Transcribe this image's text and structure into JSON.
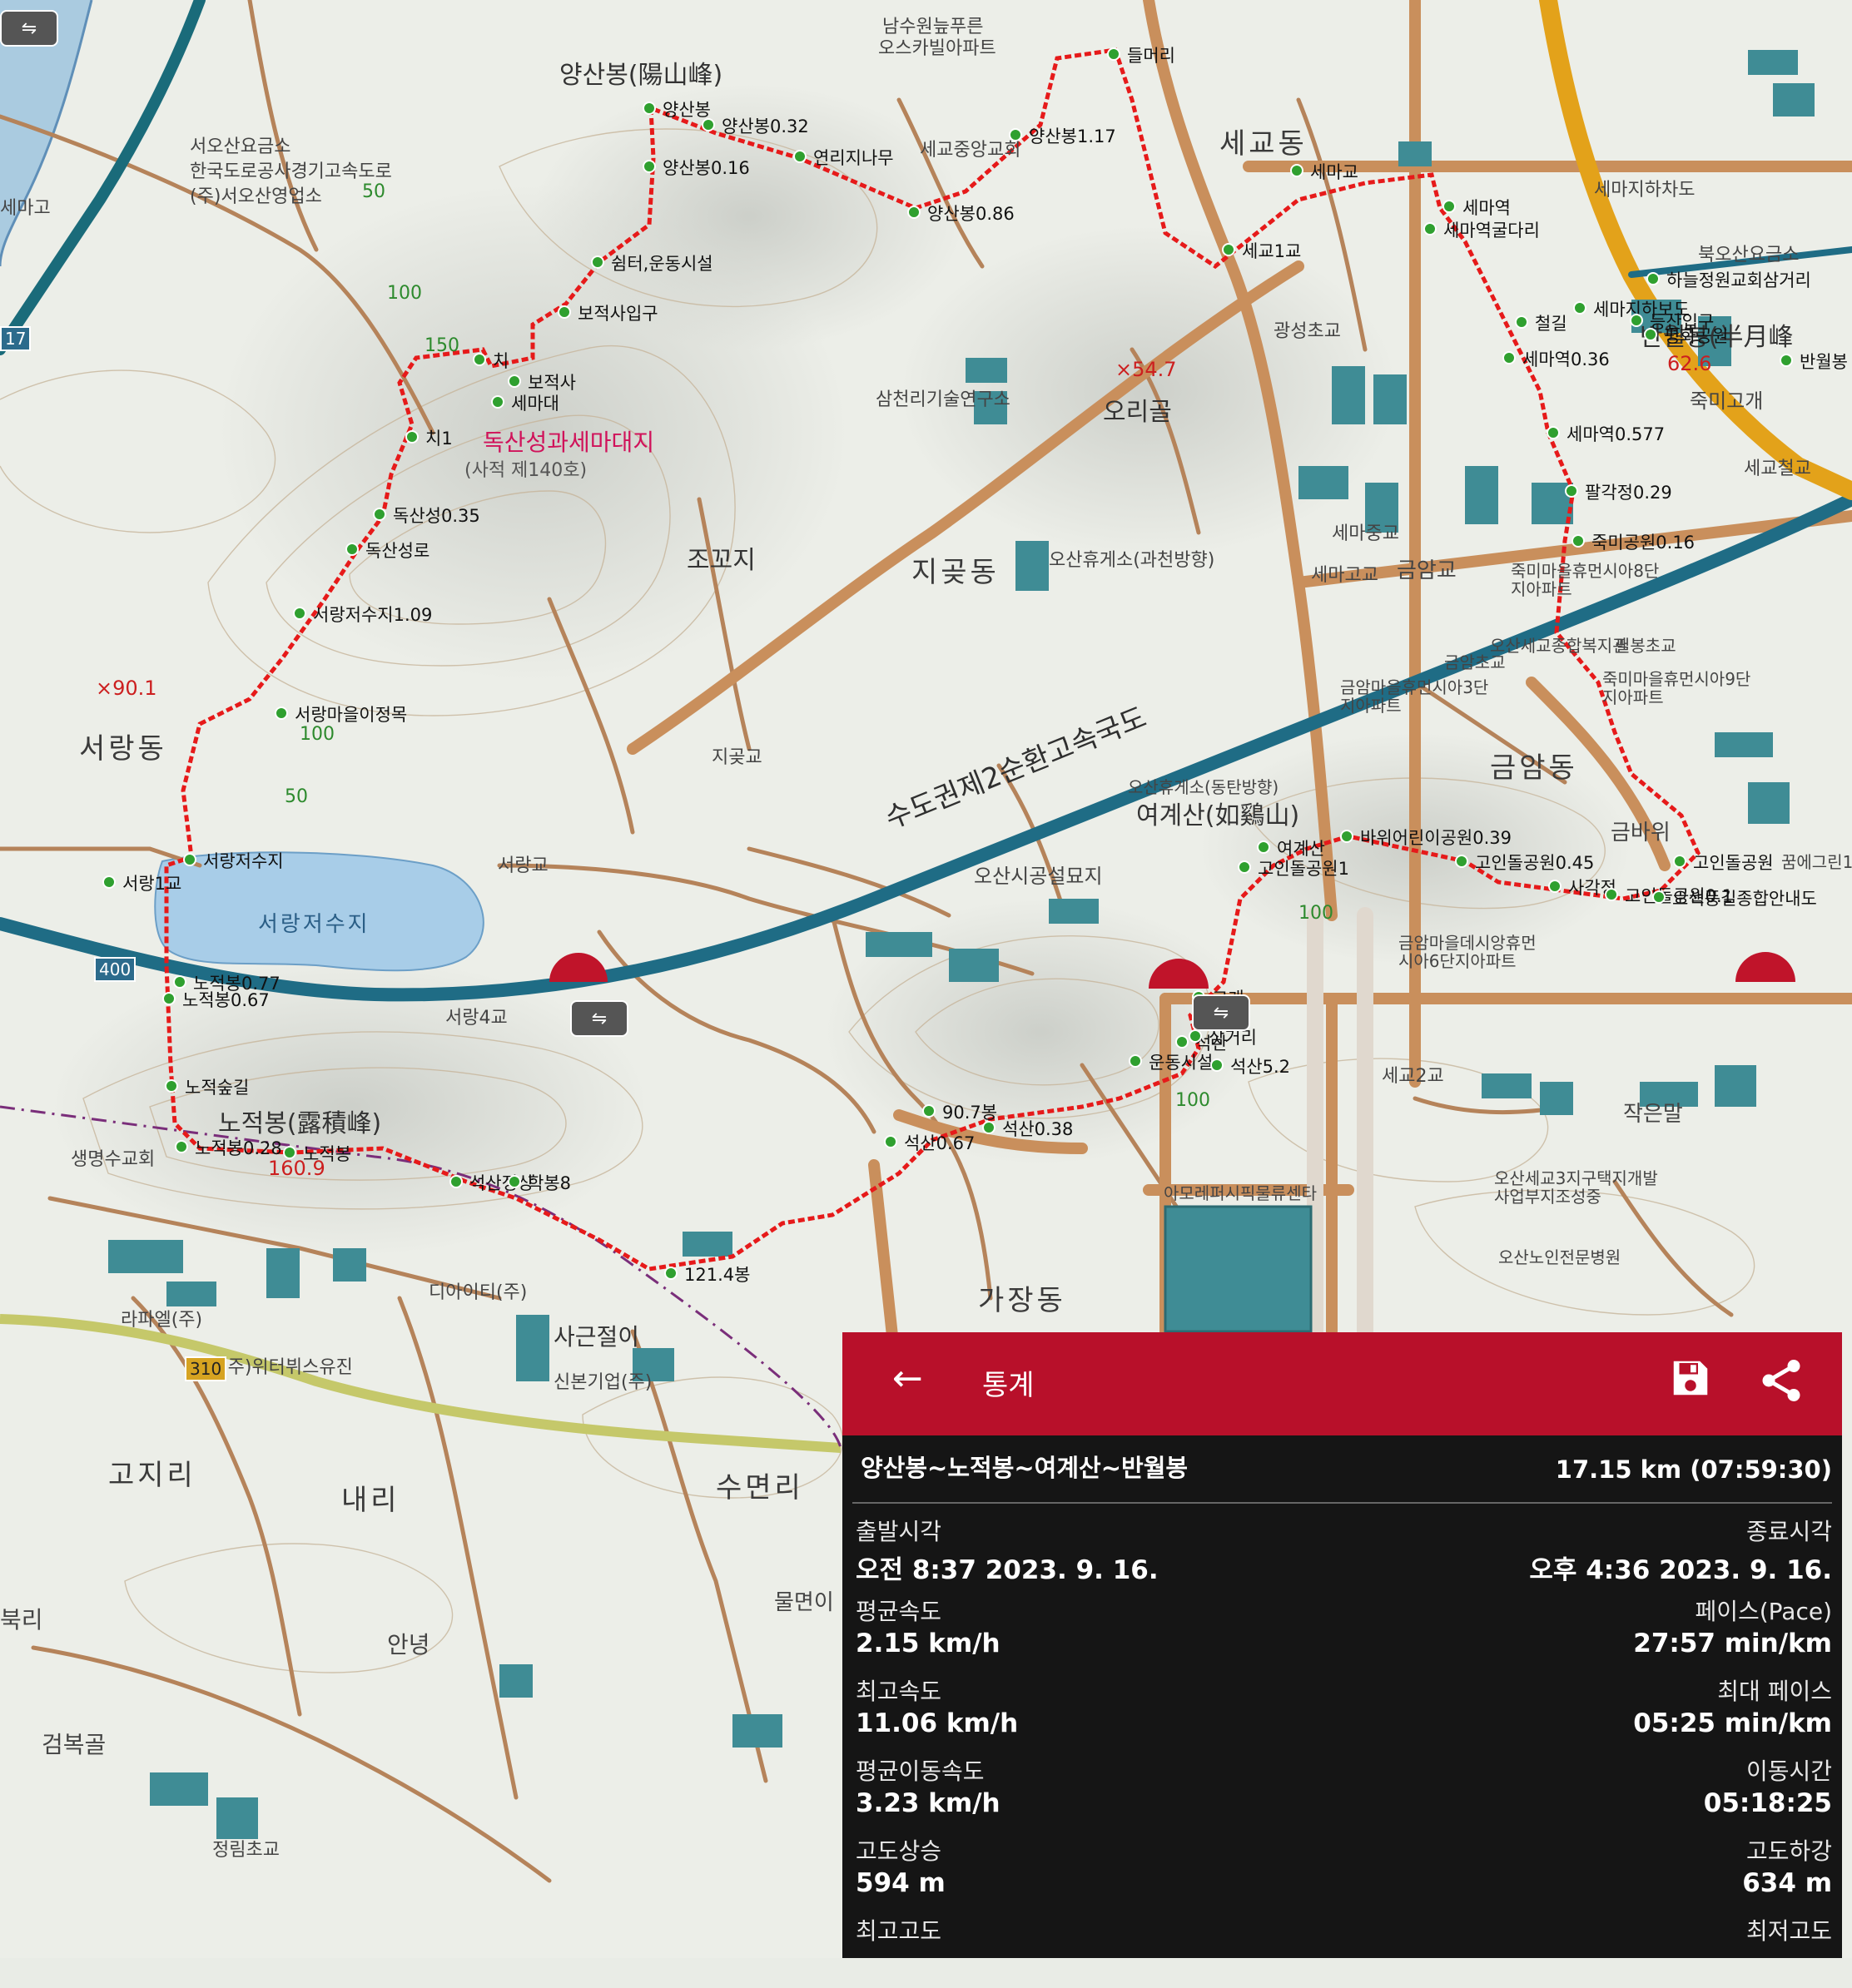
{
  "map": {
    "area_labels": [
      "서랑동",
      "지곶동",
      "가장동",
      "금암동",
      "고지리",
      "내리",
      "수면리",
      "세교동"
    ],
    "peak_labels": [
      "양산봉(陽山峰)",
      "노적봉(露積峰)",
      "여계산(如鷄山)",
      "반월봉(半月峰"
    ],
    "elevations": [
      "×90.1",
      "×54.7",
      "160.9",
      "62.6"
    ],
    "contour_labels": [
      "50",
      "100",
      "150",
      "100",
      "50",
      "100",
      "100"
    ],
    "place_labels": [
      "서오산요금소",
      "한국도로공사경기고속도로",
      "(주)서오산영업소",
      "세마고",
      "남수원늪푸른",
      "오스카빌아파트",
      "세교중앙교회",
      "삼천리기술연구소",
      "오리골",
      "광성초교",
      "세마지하차도",
      "북오산요금소",
      "죽미고개",
      "세교철교",
      "조꼬지",
      "서랑교",
      "서랑저수지",
      "지곶교",
      "서랑4교",
      "오산시공설묘지",
      "오산휴게소(과천방향)",
      "오산휴게소(동탄방향)",
      "세마중교",
      "세마고교",
      "금암교",
      "죽미마을휴먼시아8단지아파트",
      "오산세교종합복지관",
      "필봉초교",
      "금암마을휴먼시아3단지아파트",
      "죽미마을휴먼시아9단지아파트",
      "금암초교",
      "금바위",
      "꿈에그린13단지",
      "금암마을데시앙휴먼시아6단지아파트",
      "아모레퍼시픽물류센타",
      "오산세교3지구택지개발사업부지조성중",
      "오산노인전문병원",
      "작은말",
      "세교2교",
      "디아이티(주)",
      "사근절이",
      "라파엘(주)",
      "(주)위터뷔스유진",
      "신본기업(주)",
      "생명수교회",
      "안녕",
      "검복골",
      "정림초교",
      "물면이",
      "북리"
    ],
    "highway_label": "수도권제2순환고속국도",
    "route_badges": [
      "400",
      "310",
      "17"
    ],
    "heritage_label": "독산성과세마대지",
    "heritage_sub": "(사적 제140호)",
    "waypoints": [
      "양산봉",
      "양산봉0.32",
      "양산봉0.16",
      "연리지나무",
      "양산봉0.86",
      "양산봉1.17",
      "들머리",
      "쉼터,운동시설",
      "보적사입구",
      "보적사",
      "세마대",
      "치",
      "치1",
      "독산성0.35",
      "독산성로",
      "서랑저수지1.09",
      "서랑마을이정목",
      "서랑저수지",
      "서랑1교",
      "노적봉0.77",
      "노적봉0.67",
      "노적숲길",
      "노적봉0.28",
      "노적봉",
      "석산정상",
      "학봉8",
      "121.4봉",
      "석산0.67",
      "석산0.38",
      "90.7봉",
      "운동시설",
      "석산",
      "석산5.2",
      "삼거리",
      "고개",
      "여계산",
      "고인돌공원1",
      "바위어린이공원0.39",
      "고인돌공원0.45",
      "사각정",
      "고인돌공원",
      "고인돌공원0.1",
      "오색풍길종합안내도",
      "죽미공원0.16",
      "팔각정0.29",
      "세마역0.577",
      "세마역0.36",
      "철길",
      "세마역",
      "세마역굴다리",
      "세마지하보도",
      "하늘정원교회삼거리",
      "등산입구",
      "평화공원",
      "반월봉",
      "세마교",
      "세교1교"
    ]
  },
  "panel": {
    "title": "통계",
    "back_icon": "arrow-left",
    "save_icon": "save",
    "share_icon": "share",
    "track_name": "양산봉~노적봉~여계산~반월봉",
    "distance": "17.15 km (07:59:30)",
    "stats": [
      {
        "left_label": "출발시각",
        "left_value": "오전 8:37 2023. 9. 16.",
        "right_label": "종료시각",
        "right_value": "오후 4:36 2023. 9. 16."
      },
      {
        "left_label": "평균속도",
        "left_value": "2.15 km/h",
        "right_label": "페이스(Pace)",
        "right_value": "27:57 min/km"
      },
      {
        "left_label": "최고속도",
        "left_value": "11.06 km/h",
        "right_label": "최대 페이스",
        "right_value": "05:25 min/km"
      },
      {
        "left_label": "평균이동속도",
        "left_value": "3.23 km/h",
        "right_label": "이동시간",
        "right_value": "05:18:25"
      },
      {
        "left_label": "고도상승",
        "left_value": "594 m",
        "right_label": "고도하강",
        "right_value": "634 m"
      },
      {
        "left_label": "최고고도",
        "left_value": "",
        "right_label": "최저고도",
        "right_value": ""
      }
    ],
    "colors": {
      "bar": "#b8102a",
      "background": "#151515"
    }
  }
}
